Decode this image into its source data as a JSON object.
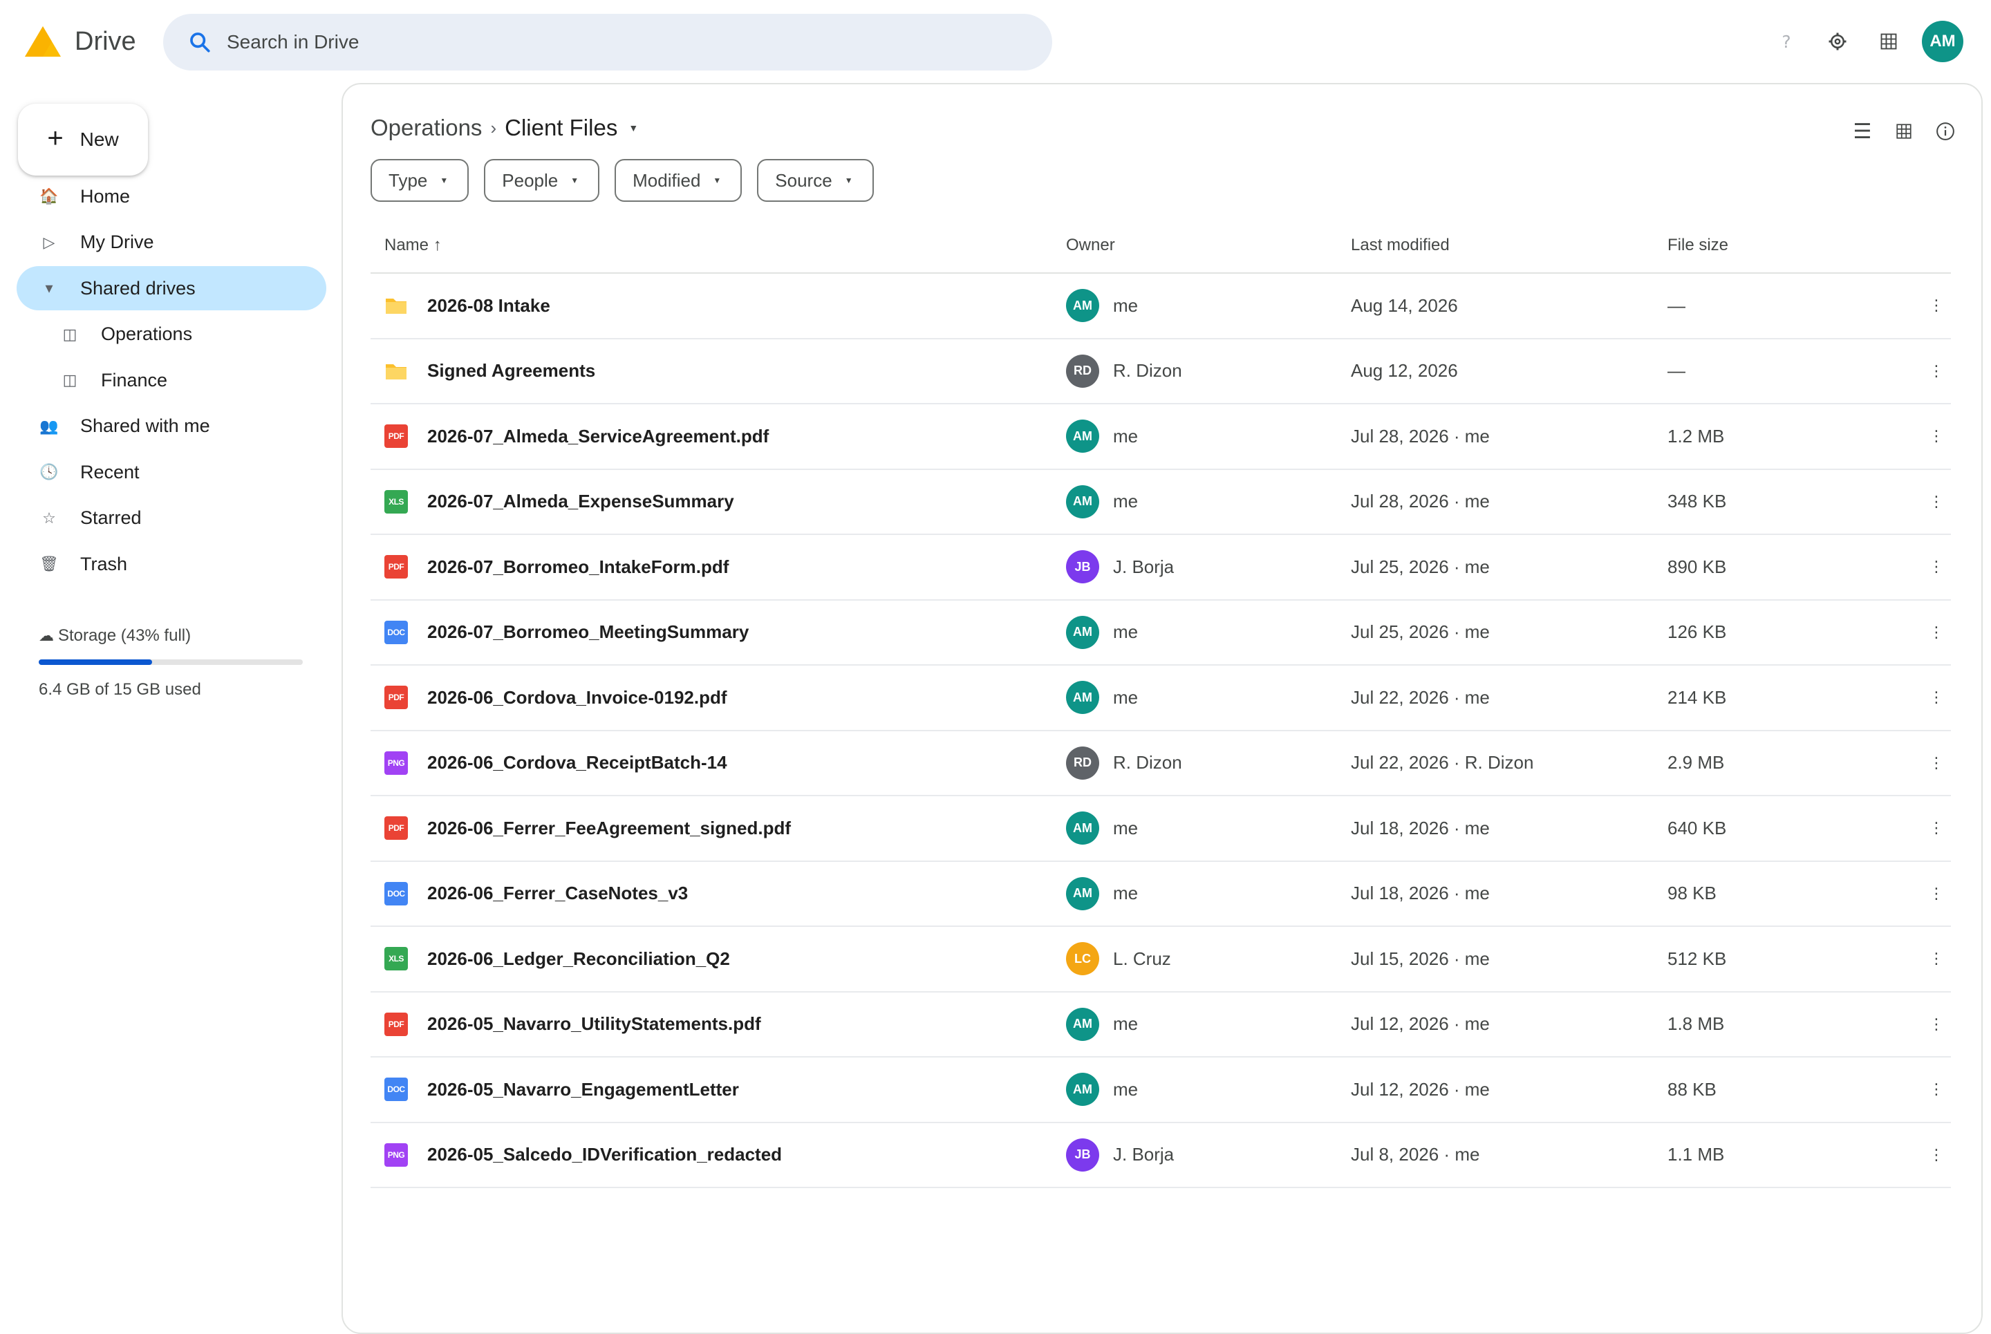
{
  "app": {
    "name": "Drive",
    "logo_colors": [
      "#fbbc04",
      "#ea8600"
    ]
  },
  "search": {
    "placeholder": "Search in Drive"
  },
  "header": {
    "icons": [
      "help-icon",
      "settings-icon",
      "apps-grid-icon"
    ],
    "avatar": {
      "initials": "AM",
      "color": "#0e9488"
    }
  },
  "sidebar": {
    "new_label": "New",
    "items": [
      {
        "label": "Home",
        "icon": "home-icon",
        "glyph": "🏠",
        "active": false,
        "sub": false
      },
      {
        "label": "My Drive",
        "icon": "my-drive-icon",
        "glyph": "▷",
        "active": false,
        "sub": false
      },
      {
        "label": "Shared drives",
        "icon": "expand-caret-icon",
        "glyph": "▾",
        "active": true,
        "sub": false
      },
      {
        "label": "Operations",
        "icon": "shared-drive-icon",
        "glyph": "◫",
        "active": false,
        "sub": true
      },
      {
        "label": "Finance",
        "icon": "shared-drive-icon",
        "glyph": "◫",
        "active": false,
        "sub": true
      },
      {
        "label": "Shared with me",
        "icon": "people-icon",
        "glyph": "👥",
        "active": false,
        "sub": false
      },
      {
        "label": "Recent",
        "icon": "clock-icon",
        "glyph": "🕓",
        "active": false,
        "sub": false
      },
      {
        "label": "Starred",
        "icon": "star-icon",
        "glyph": "☆",
        "active": false,
        "sub": false
      },
      {
        "label": "Trash",
        "icon": "trash-icon",
        "glyph": "🗑",
        "active": false,
        "sub": false
      }
    ],
    "storage": {
      "label": "Storage (43% full)",
      "used_text": "6.4 GB of 15 GB used",
      "fraction": 0.43,
      "bar_color": "#0b57d0"
    }
  },
  "main": {
    "breadcrumb": {
      "parent": "Operations",
      "current": "Client Files"
    },
    "filters": [
      "Type",
      "People",
      "Modified",
      "Source"
    ],
    "columns": {
      "name": "Name ↑",
      "owner": "Owner",
      "modified": "Last modified",
      "size": "File size"
    },
    "rows": [
      {
        "name": "2026-08 Intake",
        "type": "folder",
        "type_label": "",
        "owner": "me",
        "initials": "AM",
        "avatar_color": "#0e9488",
        "modified": "Aug 14, 2026",
        "size": "—"
      },
      {
        "name": "Signed Agreements",
        "type": "folder",
        "type_label": "",
        "owner": "R. Dizon",
        "initials": "RD",
        "avatar_color": "#5f6368",
        "modified": "Aug 12, 2026",
        "size": "—"
      },
      {
        "name": "2026-07_Almeda_ServiceAgreement.pdf",
        "type": "pdf",
        "type_label": "PDF",
        "owner": "me",
        "initials": "AM",
        "avatar_color": "#0e9488",
        "modified": "Jul 28, 2026 · me",
        "size": "1.2 MB"
      },
      {
        "name": "2026-07_Almeda_ExpenseSummary",
        "type": "xls",
        "type_label": "XLS",
        "owner": "me",
        "initials": "AM",
        "avatar_color": "#0e9488",
        "modified": "Jul 28, 2026 · me",
        "size": "348 KB"
      },
      {
        "name": "2026-07_Borromeo_IntakeForm.pdf",
        "type": "pdf",
        "type_label": "PDF",
        "owner": "J. Borja",
        "initials": "JB",
        "avatar_color": "#7c3aed",
        "modified": "Jul 25, 2026 · me",
        "size": "890 KB"
      },
      {
        "name": "2026-07_Borromeo_MeetingSummary",
        "type": "doc",
        "type_label": "DOC",
        "owner": "me",
        "initials": "AM",
        "avatar_color": "#0e9488",
        "modified": "Jul 25, 2026 · me",
        "size": "126 KB"
      },
      {
        "name": "2026-06_Cordova_Invoice-0192.pdf",
        "type": "pdf",
        "type_label": "PDF",
        "owner": "me",
        "initials": "AM",
        "avatar_color": "#0e9488",
        "modified": "Jul 22, 2026 · me",
        "size": "214 KB"
      },
      {
        "name": "2026-06_Cordova_ReceiptBatch-14",
        "type": "png",
        "type_label": "PNG",
        "owner": "R. Dizon",
        "initials": "RD",
        "avatar_color": "#5f6368",
        "modified": "Jul 22, 2026 · R. Dizon",
        "size": "2.9 MB"
      },
      {
        "name": "2026-06_Ferrer_FeeAgreement_signed.pdf",
        "type": "pdf",
        "type_label": "PDF",
        "owner": "me",
        "initials": "AM",
        "avatar_color": "#0e9488",
        "modified": "Jul 18, 2026 · me",
        "size": "640 KB"
      },
      {
        "name": "2026-06_Ferrer_CaseNotes_v3",
        "type": "doc",
        "type_label": "DOC",
        "owner": "me",
        "initials": "AM",
        "avatar_color": "#0e9488",
        "modified": "Jul 18, 2026 · me",
        "size": "98 KB"
      },
      {
        "name": "2026-06_Ledger_Reconciliation_Q2",
        "type": "xls",
        "type_label": "XLS",
        "owner": "L. Cruz",
        "initials": "LC",
        "avatar_color": "#f4a614",
        "modified": "Jul 15, 2026 · me",
        "size": "512 KB"
      },
      {
        "name": "2026-05_Navarro_UtilityStatements.pdf",
        "type": "pdf",
        "type_label": "PDF",
        "owner": "me",
        "initials": "AM",
        "avatar_color": "#0e9488",
        "modified": "Jul 12, 2026 · me",
        "size": "1.8 MB"
      },
      {
        "name": "2026-05_Navarro_EngagementLetter",
        "type": "doc",
        "type_label": "DOC",
        "owner": "me",
        "initials": "AM",
        "avatar_color": "#0e9488",
        "modified": "Jul 12, 2026 · me",
        "size": "88 KB"
      },
      {
        "name": "2026-05_Salcedo_IDVerification_redacted",
        "type": "png",
        "type_label": "PNG",
        "owner": "J. Borja",
        "initials": "JB",
        "avatar_color": "#7c3aed",
        "modified": "Jul 8, 2026 · me",
        "size": "1.1 MB"
      }
    ]
  }
}
